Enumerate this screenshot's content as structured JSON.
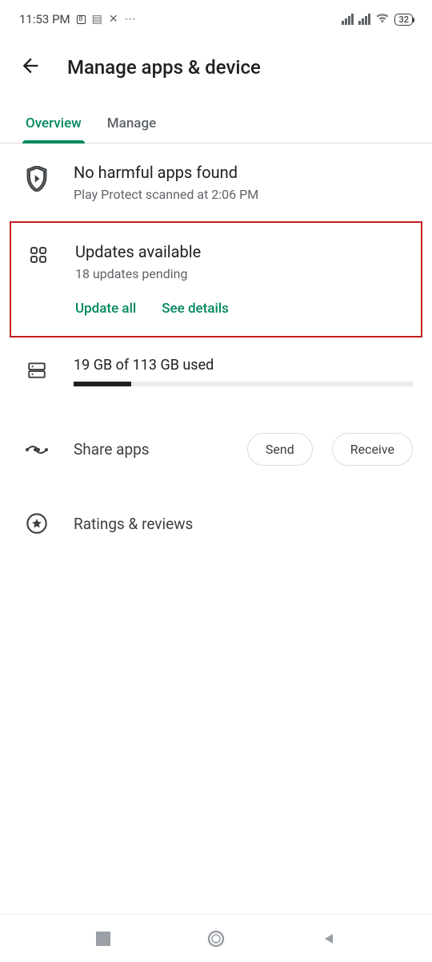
{
  "status_bar": {
    "time": "11:53 PM",
    "battery": "32"
  },
  "header": {
    "title": "Manage apps & device"
  },
  "tabs": {
    "overview": "Overview",
    "manage": "Manage"
  },
  "protect": {
    "title": "No harmful apps found",
    "subtitle": "Play Protect scanned at 2:06 PM"
  },
  "updates": {
    "title": "Updates available",
    "subtitle": "18 updates pending",
    "update_all": "Update all",
    "see_details": "See details"
  },
  "storage": {
    "text": "19 GB of 113 GB used",
    "percent": 17
  },
  "share": {
    "label": "Share apps",
    "send": "Send",
    "receive": "Receive"
  },
  "ratings": {
    "label": "Ratings & reviews"
  }
}
